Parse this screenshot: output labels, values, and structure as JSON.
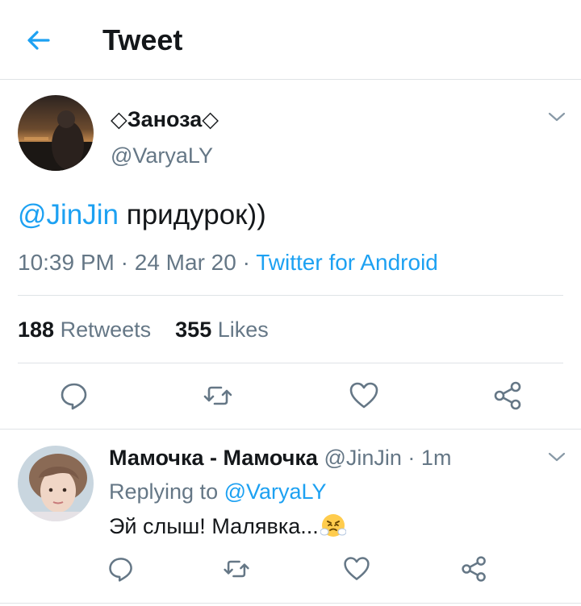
{
  "header": {
    "title": "Tweet",
    "back_icon": "arrow-left-icon"
  },
  "tweet": {
    "author_name": "◇Заноза◇",
    "author_handle": "@VaryaLY",
    "mention": "@JinJin",
    "text": " придурок))",
    "time": "10:39 PM",
    "date": "24 Mar 20",
    "separator": " · ",
    "source": "Twitter for Android",
    "retweets_count": "188",
    "retweets_label": "Retweets",
    "likes_count": "355",
    "likes_label": "Likes"
  },
  "reply": {
    "author_name": "Мамочка - Мамочка",
    "author_handle": "@JinJin",
    "time_ago": "1m",
    "replying_to_label": "Replying to",
    "replying_to_handle": "@VaryaLY",
    "text": "Эй слыш! Малявка...",
    "emoji": "face-with-steam-from-nose"
  },
  "colors": {
    "accent": "#1da1f2",
    "secondary_text": "#657786",
    "primary_text": "#14171a",
    "divider": "#dfe3e6"
  }
}
